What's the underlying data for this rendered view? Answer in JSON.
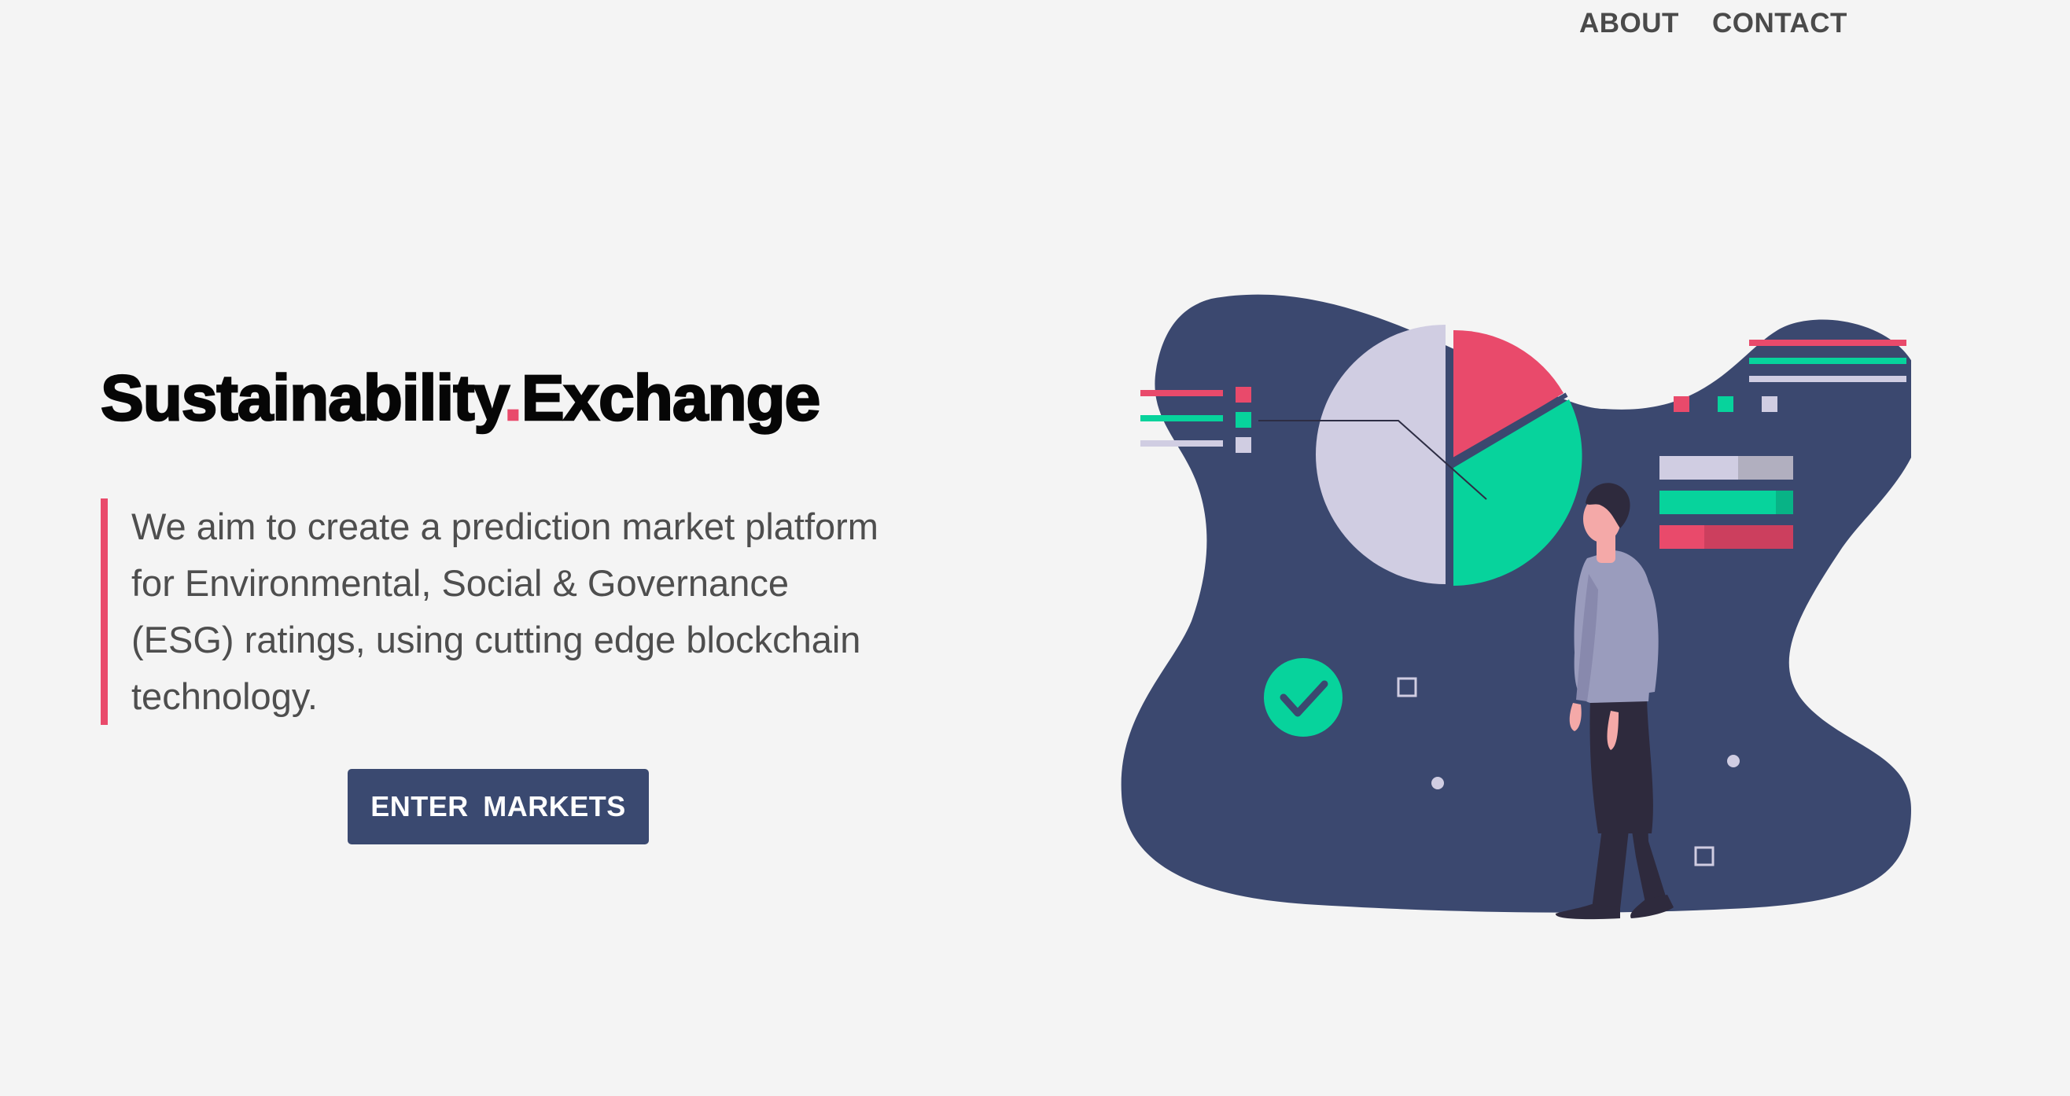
{
  "nav": {
    "about_label": "ABOUT",
    "contact_label": "CONTACT"
  },
  "hero": {
    "title_part1": "Sustainability",
    "title_dot": ".",
    "title_part2": "Exchange",
    "tagline": "We aim to create a prediction market platform for Environmental, Social & Governance (ESG) ratings, using cutting edge blockchain technology.",
    "cta_label": "ENTER MARKETS"
  },
  "illustration": {
    "description_icon": "person-analytics-illustration",
    "pie_slices": [
      {
        "label": "red",
        "fraction": 0.2
      },
      {
        "label": "green",
        "fraction": 0.3
      },
      {
        "label": "lavender",
        "fraction": 0.5
      }
    ]
  },
  "colors": {
    "background": "#f4f4f4",
    "text": "#4a4a4a",
    "accent_pink": "#e94a6b",
    "button_navy": "#3a4970",
    "blob_navy": "#3b486f",
    "green": "#07d39c",
    "lavender": "#d0cde2"
  }
}
